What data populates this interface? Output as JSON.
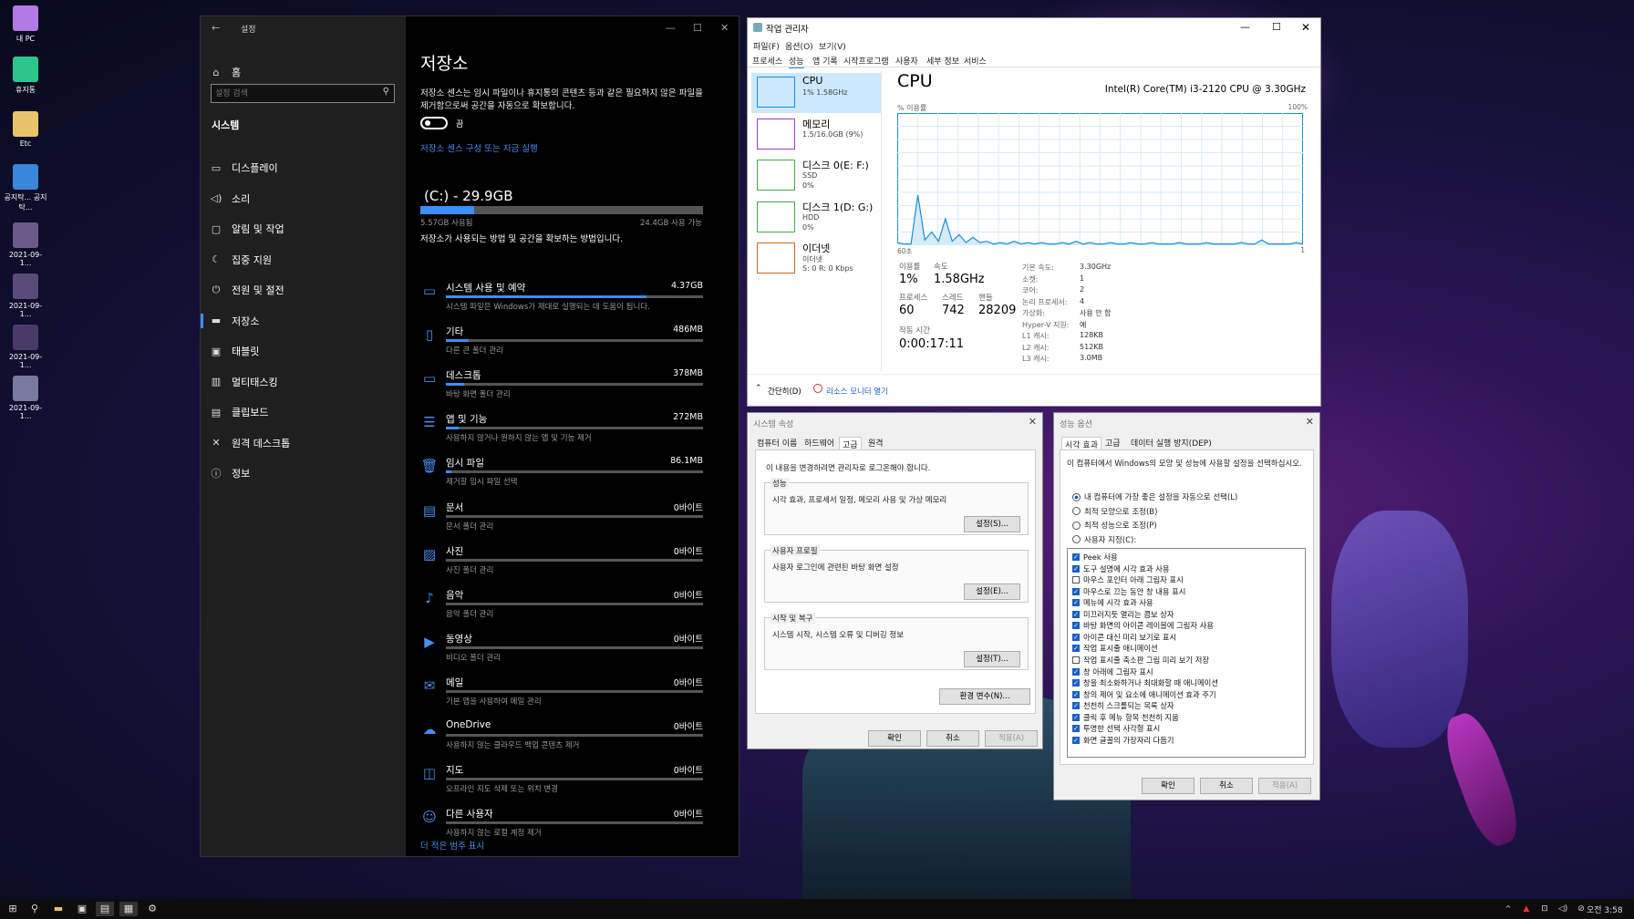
{
  "desktop": {
    "icons": [
      {
        "label": "내 PC",
        "icon": "monitor-icon",
        "color": "#b47ae6"
      },
      {
        "label": "휴지통",
        "icon": "trash-icon",
        "color": "#2ec58a"
      },
      {
        "label": "Etc",
        "icon": "folder-icon",
        "color": "#e8c36a"
      },
      {
        "label": "공지탁... 공지탁...",
        "icon": "ie-icon",
        "color": "#3a86d8"
      },
      {
        "label": "2021-09-1...",
        "icon": "image-icon",
        "color": "#6b5a8a"
      },
      {
        "label": "2021-09-1...",
        "icon": "image-icon",
        "color": "#5a4a7a"
      },
      {
        "label": "2021-09-1...",
        "icon": "image-icon",
        "color": "#4a3a6a"
      },
      {
        "label": "2021-09-1...",
        "icon": "image-icon",
        "color": "#7a7aa0"
      }
    ]
  },
  "settings": {
    "title": "설정",
    "home": "홈",
    "search_placeholder": "설정 검색",
    "section": "시스템",
    "nav": [
      {
        "label": "디스플레이",
        "icon": "display-icon"
      },
      {
        "label": "소리",
        "icon": "sound-icon"
      },
      {
        "label": "알림 및 작업",
        "icon": "notification-icon"
      },
      {
        "label": "집중 지원",
        "icon": "moon-icon"
      },
      {
        "label": "전원 및 절전",
        "icon": "power-icon"
      },
      {
        "label": "저장소",
        "icon": "storage-icon",
        "active": true
      },
      {
        "label": "태블릿",
        "icon": "tablet-icon"
      },
      {
        "label": "멀티태스킹",
        "icon": "multitask-icon"
      },
      {
        "label": "클립보드",
        "icon": "clipboard-icon"
      },
      {
        "label": "원격 데스크톱",
        "icon": "remote-icon"
      },
      {
        "label": "정보",
        "icon": "info-icon"
      }
    ],
    "page_title": "저장소",
    "sense_desc": "저장소 센스는 임시 파일이나 휴지통의 콘텐츠 등과 같은 필요하지 않은 파일을 제거함으로써 공간을 자동으로 확보합니다.",
    "toggle_label": "끔",
    "sense_link": "저장소 센스 구성 또는 지금 실행",
    "drive_title": "(C:) - 29.9GB",
    "used": "5.57GB 사용됨",
    "free": "24.4GB 사용 가능",
    "used_fraction": 0.19,
    "how_text": "저장소가 사용되는 방법 및 공간을 확보하는 방법입니다.",
    "categories": [
      {
        "name": "시스템 사용 및 예약",
        "size": "4.37GB",
        "desc": "시스템 파일은 Windows가 제대로 실행되는 데 도움이 됩니다.",
        "fraction": 0.78,
        "icon": "system-icon"
      },
      {
        "name": "기타",
        "size": "486MB",
        "desc": "다른 큰 폴더 관리",
        "fraction": 0.09,
        "icon": "other-icon"
      },
      {
        "name": "데스크톱",
        "size": "378MB",
        "desc": "바탕 화면 폴더 관리",
        "fraction": 0.07,
        "icon": "desktop-icon"
      },
      {
        "name": "앱 및 기능",
        "size": "272MB",
        "desc": "사용하지 않거나 원하지 않는 앱 및 기능 제거",
        "fraction": 0.05,
        "icon": "apps-icon"
      },
      {
        "name": "임시 파일",
        "size": "86.1MB",
        "desc": "제거할 임시 파일 선택",
        "fraction": 0.02,
        "icon": "trash-icon"
      },
      {
        "name": "문서",
        "size": "0바이트",
        "desc": "문서 폴더 관리",
        "fraction": 0,
        "icon": "documents-icon"
      },
      {
        "name": "사진",
        "size": "0바이트",
        "desc": "사진 폴더 관리",
        "fraction": 0,
        "icon": "pictures-icon"
      },
      {
        "name": "음악",
        "size": "0바이트",
        "desc": "음악 폴더 관리",
        "fraction": 0,
        "icon": "music-icon"
      },
      {
        "name": "동영상",
        "size": "0바이트",
        "desc": "비디오 폴더 관리",
        "fraction": 0,
        "icon": "video-icon"
      },
      {
        "name": "메일",
        "size": "0바이트",
        "desc": "기본 앱을 사용하여 메일 관리",
        "fraction": 0,
        "icon": "mail-icon"
      },
      {
        "name": "OneDrive",
        "size": "0바이트",
        "desc": "사용하지 않는 클라우드 백업 콘텐츠 제거",
        "fraction": 0,
        "icon": "cloud-icon"
      },
      {
        "name": "지도",
        "size": "0바이트",
        "desc": "오프라인 지도 삭제 또는 위치 변경",
        "fraction": 0,
        "icon": "map-icon"
      },
      {
        "name": "다른 사용자",
        "size": "0바이트",
        "desc": "사용하지 않는 로컬 계정 제거",
        "fraction": 0,
        "icon": "users-icon"
      }
    ],
    "more_link": "더 적은 범주 표시"
  },
  "taskmgr": {
    "title": "작업 관리자",
    "menu": [
      "파일(F)",
      "옵션(O)",
      "보기(V)"
    ],
    "tabs": [
      "프로세스",
      "성능",
      "앱 기록",
      "시작프로그램",
      "사용자",
      "세부 정보",
      "서비스"
    ],
    "resources": [
      {
        "name": "CPU",
        "sub1": "1% 1.58GHz",
        "color": "#1a8fd8"
      },
      {
        "name": "메모리",
        "sub1": "1.5/16.0GB (9%)",
        "color": "#9b3fbf"
      },
      {
        "name": "디스크 0(E: F:)",
        "sub1": "SSD",
        "sub2": "0%",
        "color": "#4aa64a"
      },
      {
        "name": "디스크 1(D: G:)",
        "sub1": "HDD",
        "sub2": "0%",
        "color": "#4aa64a"
      },
      {
        "name": "이더넷",
        "sub1": "이더넷",
        "sub2": "S: 0 R: 0 Kbps",
        "color": "#c86b1e"
      }
    ],
    "cpu_title": "CPU",
    "cpu_model": "Intel(R) Core(TM) i3-2120 CPU @ 3.30GHz",
    "graph_label": "% 이용률",
    "graph_max": "100%",
    "graph_left": "60초",
    "graph_right": "1",
    "chart_data": {
      "type": "area",
      "x_range": [
        60,
        0
      ],
      "ylim": [
        0,
        100
      ],
      "values": [
        2,
        1,
        1,
        38,
        4,
        10,
        3,
        20,
        3,
        8,
        2,
        6,
        2,
        3,
        1,
        2,
        1,
        3,
        1,
        2,
        1,
        2,
        1,
        1,
        2,
        1,
        3,
        1,
        2,
        1,
        1,
        2,
        1,
        1,
        2,
        1,
        1,
        2,
        1,
        1,
        1,
        2,
        1,
        1,
        1,
        2,
        1,
        1,
        1,
        1,
        2,
        1,
        1,
        4,
        1,
        1,
        1,
        1,
        2,
        1
      ]
    },
    "stats": {
      "util_label": "이용률",
      "util": "1%",
      "speed_label": "속도",
      "speed": "1.58GHz",
      "proc_label": "프로세스",
      "proc": "60",
      "thread_label": "스레드",
      "thread": "742",
      "handle_label": "핸들",
      "handle": "28209",
      "uptime_label": "작동 시간",
      "uptime": "0:00:17:11"
    },
    "specs": [
      [
        "기본 속도:",
        "3.30GHz"
      ],
      [
        "소켓:",
        "1"
      ],
      [
        "코어:",
        "2"
      ],
      [
        "논리 프로세서:",
        "4"
      ],
      [
        "가상화:",
        "사용 안 함"
      ],
      [
        "Hyper-V 지원:",
        "예"
      ],
      [
        "L1 캐시:",
        "128KB"
      ],
      [
        "L2 캐시:",
        "512KB"
      ],
      [
        "L3 캐시:",
        "3.0MB"
      ]
    ],
    "fewer_details": "간단히(D)",
    "resmon": "리소스 모니터 열기"
  },
  "sysprops": {
    "title": "시스템 속성",
    "tabs": [
      "컴퓨터 이름",
      "하드웨어",
      "고급",
      "원격"
    ],
    "admin_note": "이 내용을 변경하려면 관리자로 로그온해야 합니다.",
    "groups": [
      {
        "title": "성능",
        "desc": "시각 효과, 프로세서 일정, 메모리 사용 및 가상 메모리",
        "button": "설정(S)..."
      },
      {
        "title": "사용자 프로필",
        "desc": "사용자 로그인에 관련된 바탕 화면 설정",
        "button": "설정(E)..."
      },
      {
        "title": "시작 및 복구",
        "desc": "시스템 시작, 시스템 오류 및 디버깅 정보",
        "button": "설정(T)..."
      }
    ],
    "env_button": "환경 변수(N)...",
    "ok": "확인",
    "cancel": "취소",
    "apply": "적용(A)"
  },
  "perfopts": {
    "title": "성능 옵션",
    "tabs": [
      "시각 효과",
      "고급",
      "데이터 실행 방지(DEP)"
    ],
    "intro": "이 컴퓨터에서 Windows의 모양 및 성능에 사용할 설정을 선택하십시오.",
    "radios": [
      {
        "label": "내 컴퓨터에 가장 좋은 설정을 자동으로 선택(L)",
        "on": true
      },
      {
        "label": "최적 모양으로 조정(B)",
        "on": false
      },
      {
        "label": "최적 성능으로 조정(P)",
        "on": false
      },
      {
        "label": "사용자 지정(C):",
        "on": false
      }
    ],
    "checks": [
      {
        "label": "Peek 사용",
        "on": true
      },
      {
        "label": "도구 설명에 시각 효과 사용",
        "on": true
      },
      {
        "label": "마우스 포인터 아래 그림자 표시",
        "on": false
      },
      {
        "label": "마우스로 끄는 동안 창 내용 표시",
        "on": true
      },
      {
        "label": "메뉴에 시각 효과 사용",
        "on": true
      },
      {
        "label": "미끄러지듯 열리는 콤보 상자",
        "on": true
      },
      {
        "label": "바탕 화면의 아이콘 레이블에 그림자 사용",
        "on": true
      },
      {
        "label": "아이콘 대신 미리 보기로 표시",
        "on": true
      },
      {
        "label": "작업 표시줄 애니메이션",
        "on": true
      },
      {
        "label": "작업 표시줄 축소판 그림 미리 보기 저장",
        "on": false
      },
      {
        "label": "창 아래에 그림자 표시",
        "on": true
      },
      {
        "label": "창을 최소화하거나 최대화할 때 애니메이션",
        "on": true
      },
      {
        "label": "창의 제어 및 요소에 애니메이션 효과 주기",
        "on": true
      },
      {
        "label": "천천히 스크롤되는 목록 상자",
        "on": true
      },
      {
        "label": "클릭 후 메뉴 항목 천천히 지움",
        "on": true
      },
      {
        "label": "투명한 선택 사각형 표시",
        "on": true
      },
      {
        "label": "화면 글꼴의 가장자리 다듬기",
        "on": true
      }
    ],
    "ok": "확인",
    "cancel": "취소",
    "apply": "적용(A)"
  },
  "taskbar": {
    "clock": "오전 3:58"
  }
}
